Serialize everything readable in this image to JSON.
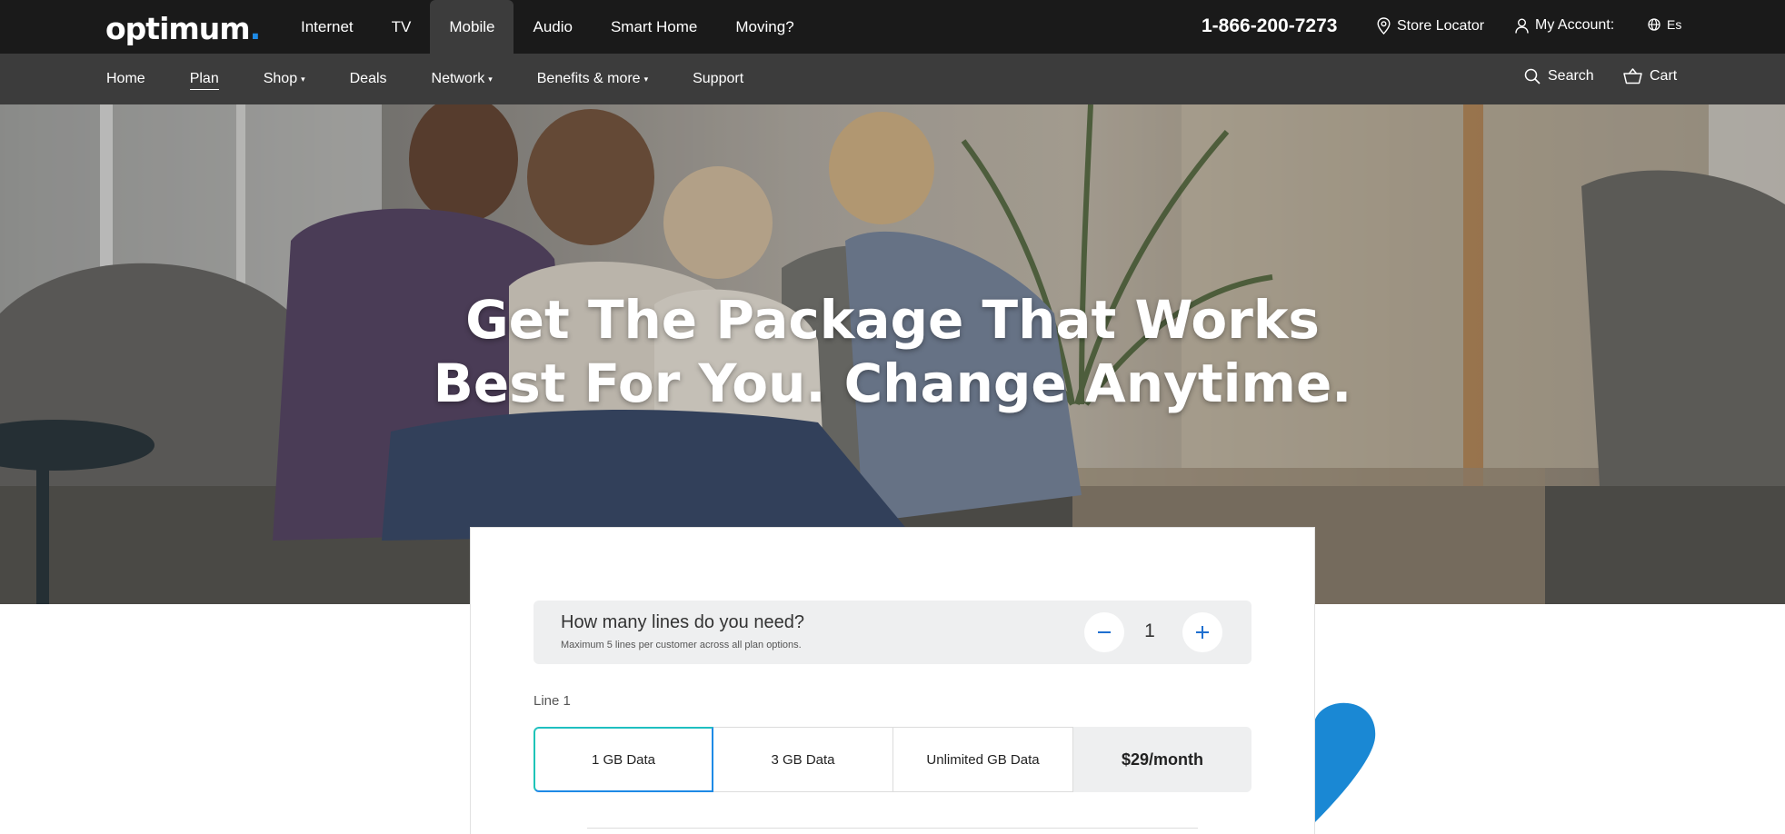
{
  "brand": {
    "logo_text": "optimum",
    "logo_dot": ".",
    "accent": "#1e8ae6",
    "topbar_bg": "#1a1a1a",
    "subbar_bg": "#3c3c3c"
  },
  "topnav": {
    "items": [
      {
        "label": "Internet"
      },
      {
        "label": "TV"
      },
      {
        "label": "Mobile",
        "active": true
      },
      {
        "label": "Audio"
      },
      {
        "label": "Smart Home"
      },
      {
        "label": "Moving?"
      }
    ],
    "phone": "1-866-200-7273",
    "store_locator": {
      "label": "Store Locator",
      "icon": "map-pin-icon"
    },
    "account": {
      "label": "My Account:",
      "icon": "user-icon"
    },
    "language": {
      "label": "Es",
      "icon": "globe-icon"
    }
  },
  "subnav": {
    "items": [
      {
        "label": "Home"
      },
      {
        "label": "Plan",
        "current": true
      },
      {
        "label": "Shop",
        "caret": "▾"
      },
      {
        "label": "Deals"
      },
      {
        "label": "Network",
        "caret": "▾"
      },
      {
        "label": "Benefits & more",
        "caret": "▾"
      },
      {
        "label": "Support"
      }
    ],
    "search": {
      "label": "Search",
      "icon": "search-icon"
    },
    "cart": {
      "label": "Cart",
      "icon": "cart-icon"
    }
  },
  "hero": {
    "title_line1": "Get The Package That Works",
    "title_line2": "Best For You. Change Anytime."
  },
  "plan_builder": {
    "question": "How many lines do you need?",
    "note": "Maximum 5 lines per customer across all plan options.",
    "line_count": "1",
    "decrement_icon": "minus-icon",
    "increment_icon": "plus-icon",
    "line_label": "Line 1",
    "options": [
      {
        "label": "1 GB Data",
        "selected": true
      },
      {
        "label": "3 GB Data"
      },
      {
        "label": "Unlimited GB Data"
      }
    ],
    "price": "$29/month"
  }
}
